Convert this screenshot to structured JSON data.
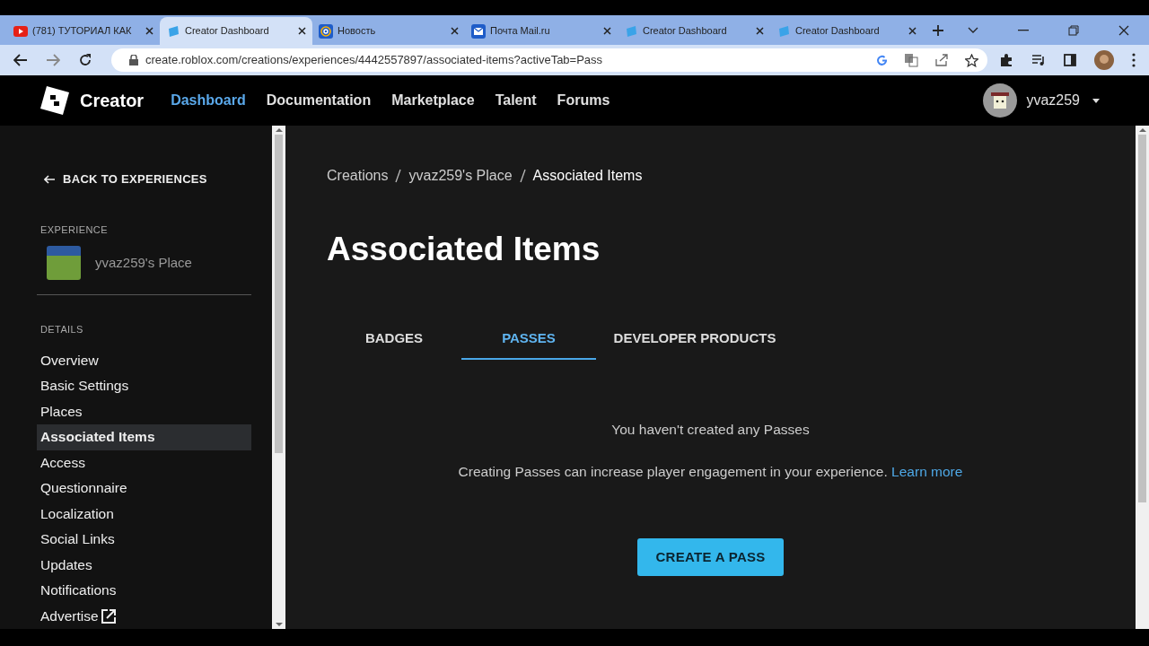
{
  "browser": {
    "tabs": [
      {
        "title": "(781) ТУТОРИАЛ КАК",
        "kind": "video",
        "selected": false
      },
      {
        "title": "Creator Dashboard",
        "kind": "studio",
        "selected": true
      },
      {
        "title": "Новость",
        "kind": "at",
        "selected": false
      },
      {
        "title": "Почта Mail.ru",
        "kind": "envelope",
        "selected": false
      },
      {
        "title": "Creator Dashboard",
        "kind": "studio",
        "selected": false
      },
      {
        "title": "Creator Dashboard",
        "kind": "studio",
        "selected": false
      }
    ],
    "url": "create.roblox.com/creations/experiences/4442557897/associated-items?activeTab=Pass"
  },
  "header": {
    "logo_text": "Creator",
    "nav": [
      {
        "label": "Dashboard",
        "selected": true
      },
      {
        "label": "Documentation",
        "selected": false
      },
      {
        "label": "Marketplace",
        "selected": false
      },
      {
        "label": "Talent",
        "selected": false
      },
      {
        "label": "Forums",
        "selected": false
      }
    ],
    "user": "yvaz259"
  },
  "sidebar": {
    "back": "BACK TO EXPERIENCES",
    "experience_label": "EXPERIENCE",
    "experience_name": "yvaz259's Place",
    "details_label": "DETAILS",
    "items": [
      {
        "label": "Overview",
        "selected": false,
        "external": false
      },
      {
        "label": "Basic Settings",
        "selected": false,
        "external": false
      },
      {
        "label": "Places",
        "selected": false,
        "external": false
      },
      {
        "label": "Associated Items",
        "selected": true,
        "external": false
      },
      {
        "label": "Access",
        "selected": false,
        "external": false
      },
      {
        "label": "Questionnaire",
        "selected": false,
        "external": false
      },
      {
        "label": "Localization",
        "selected": false,
        "external": false
      },
      {
        "label": "Social Links",
        "selected": false,
        "external": false
      },
      {
        "label": "Updates",
        "selected": false,
        "external": false
      },
      {
        "label": "Notifications",
        "selected": false,
        "external": false
      },
      {
        "label": "Advertise",
        "selected": false,
        "external": true
      }
    ]
  },
  "main": {
    "breadcrumbs": [
      "Creations",
      "yvaz259's Place",
      "Associated Items"
    ],
    "title": "Associated Items",
    "tabs": [
      {
        "label": "BADGES",
        "selected": false
      },
      {
        "label": "PASSES",
        "selected": true
      },
      {
        "label": "DEVELOPER PRODUCTS",
        "selected": false
      }
    ],
    "empty_title": "You haven't created any Passes",
    "empty_text": "Creating Passes can increase player engagement in your experience.",
    "learn_more": "Learn more",
    "create_button": "CREATE A PASS"
  }
}
